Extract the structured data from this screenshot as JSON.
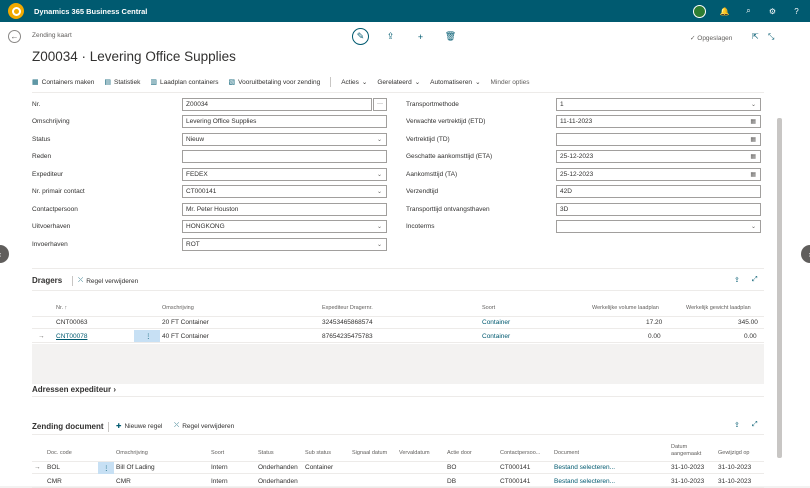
{
  "app": {
    "title": "Dynamics 365 Business Central"
  },
  "breadcrumb": "Zending kaart",
  "page_title": "Z00034 · Levering Office Supplies",
  "status_saved": "Opgeslagen",
  "actions": [
    "Containers maken",
    "Statistiek",
    "Laadplan containers",
    "Vooruitbetaling voor zending",
    "Acties",
    "Gerelateerd",
    "Automatiseren",
    "Minder opties"
  ],
  "left_fields": [
    {
      "label": "Nr.",
      "value": "Z00034"
    },
    {
      "label": "Omschrijving",
      "value": "Levering Office Supplies"
    },
    {
      "label": "Status",
      "value": "Nieuw"
    },
    {
      "label": "Reden",
      "value": ""
    },
    {
      "label": "Expediteur",
      "value": "FEDEX"
    },
    {
      "label": "Nr. primair contact",
      "value": "CT000141"
    },
    {
      "label": "Contactpersoon",
      "value": "Mr. Peter Houston"
    },
    {
      "label": "Uitvoerhaven",
      "value": "HONGKONG"
    },
    {
      "label": "Invoerhaven",
      "value": "ROT"
    }
  ],
  "right_fields": [
    {
      "label": "Transportmethode",
      "value": "1"
    },
    {
      "label": "Verwachte vertrektijd (ETD)",
      "value": "11-11-2023"
    },
    {
      "label": "Vertrektijd (TD)",
      "value": ""
    },
    {
      "label": "Geschatte aankomsttijd (ETA)",
      "value": "25-12-2023"
    },
    {
      "label": "Aankomsttijd (TA)",
      "value": "25-12-2023"
    },
    {
      "label": "Verzendtijd",
      "value": "42D"
    },
    {
      "label": "Transporttijd ontvangsthaven",
      "value": "3D"
    },
    {
      "label": "Incoterms",
      "value": ""
    }
  ],
  "dragers": {
    "title": "Dragers",
    "remove_label": "Regel verwijderen",
    "headers": [
      "Nr. ↑",
      "Omschrijving",
      "Expediteur Dragernr.",
      "Soort",
      "Werkelijke volume laadplan",
      "Werkelijk gewicht laadplan"
    ],
    "rows": [
      [
        "CNT00063",
        "20 FT Container",
        "32453465868574",
        "Container",
        "17.20",
        "345.00"
      ],
      [
        "CNT00078",
        "40 FT Container",
        "87654235475783",
        "Container",
        "0.00",
        "0.00"
      ]
    ]
  },
  "adressen": {
    "title": "Adressen expediteur"
  },
  "zending_doc": {
    "title": "Zending document",
    "new_label": "Nieuwe regel",
    "remove_label": "Regel verwijderen",
    "headers": [
      "Doc. code",
      "Omschrijving",
      "Soort",
      "Status",
      "Sub status",
      "Signaal datum",
      "Vervaldatum",
      "Actie door",
      "Contactpersoo...",
      "Document",
      "Datum aangemaakt",
      "Gewijzigd op"
    ],
    "rows": [
      [
        "BOL",
        "Bill Of Lading",
        "Intern",
        "Onderhanden",
        "Container",
        "",
        "",
        "BO",
        "CT000141",
        "Bestand selecteren...",
        "31-10-2023",
        "31-10-2023"
      ],
      [
        "CMR",
        "CMR",
        "Intern",
        "Onderhanden",
        "",
        "",
        "",
        "DB",
        "CT000141",
        "Bestand selecteren...",
        "31-10-2023",
        "31-10-2023"
      ]
    ]
  },
  "colors": {
    "brand": "#005a70",
    "accent": "#f2a900",
    "selected": "#c7e0f4"
  }
}
